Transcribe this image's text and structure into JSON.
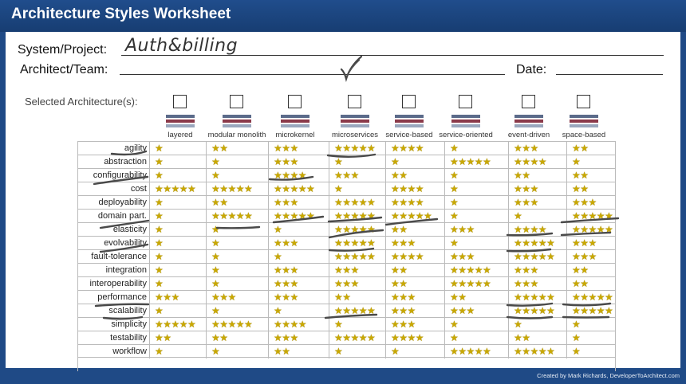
{
  "title": "Architecture Styles Worksheet",
  "form": {
    "system_label": "System/Project:",
    "system_value": "Auth&billing",
    "architect_label": "Architect/Team:",
    "architect_value": "",
    "date_label": "Date:",
    "date_value": ""
  },
  "selected_label": "Selected Architecture(s):",
  "architectures": [
    {
      "name": "layered",
      "checked": false
    },
    {
      "name": "modular monolith",
      "checked": false
    },
    {
      "name": "microkernel",
      "checked": false
    },
    {
      "name": "microservices",
      "checked": true
    },
    {
      "name": "service-based",
      "checked": false
    },
    {
      "name": "service-oriented",
      "checked": false
    },
    {
      "name": "event-driven",
      "checked": false
    },
    {
      "name": "space-based",
      "checked": false
    }
  ],
  "criteria": [
    {
      "name": "agility",
      "ratings": [
        1,
        2,
        3,
        5,
        4,
        1,
        3,
        2
      ]
    },
    {
      "name": "abstraction",
      "ratings": [
        1,
        1,
        3,
        1,
        1,
        5,
        4,
        1
      ]
    },
    {
      "name": "configurability",
      "ratings": [
        1,
        1,
        4,
        3,
        2,
        1,
        2,
        2
      ]
    },
    {
      "name": "cost",
      "ratings": [
        5,
        5,
        5,
        1,
        4,
        1,
        3,
        2
      ]
    },
    {
      "name": "deployability",
      "ratings": [
        1,
        2,
        3,
        5,
        4,
        1,
        3,
        3
      ]
    },
    {
      "name": "domain part.",
      "ratings": [
        1,
        5,
        5,
        5,
        5,
        1,
        1,
        5
      ]
    },
    {
      "name": "elasticity",
      "ratings": [
        1,
        1,
        1,
        5,
        2,
        3,
        4,
        5
      ]
    },
    {
      "name": "evolvability",
      "ratings": [
        1,
        1,
        3,
        5,
        3,
        1,
        5,
        3
      ]
    },
    {
      "name": "fault-tolerance",
      "ratings": [
        1,
        1,
        1,
        5,
        4,
        3,
        5,
        3
      ]
    },
    {
      "name": "integration",
      "ratings": [
        1,
        1,
        3,
        3,
        2,
        5,
        3,
        2
      ]
    },
    {
      "name": "interoperability",
      "ratings": [
        1,
        1,
        3,
        3,
        2,
        5,
        3,
        2
      ]
    },
    {
      "name": "performance",
      "ratings": [
        3,
        3,
        3,
        2,
        3,
        2,
        5,
        5
      ]
    },
    {
      "name": "scalability",
      "ratings": [
        1,
        1,
        1,
        5,
        3,
        3,
        5,
        5
      ]
    },
    {
      "name": "simplicity",
      "ratings": [
        5,
        5,
        4,
        1,
        3,
        1,
        1,
        1
      ]
    },
    {
      "name": "testability",
      "ratings": [
        2,
        2,
        3,
        5,
        4,
        1,
        2,
        1
      ]
    },
    {
      "name": "workflow",
      "ratings": [
        1,
        1,
        2,
        1,
        1,
        5,
        5,
        1
      ]
    }
  ],
  "star_glyph": "★",
  "colors": {
    "header": "#1f4a86",
    "star": "#e6c200",
    "pen": "#444444"
  },
  "credit": "Created by Mark Richards, DeveloperToArchitect.com"
}
